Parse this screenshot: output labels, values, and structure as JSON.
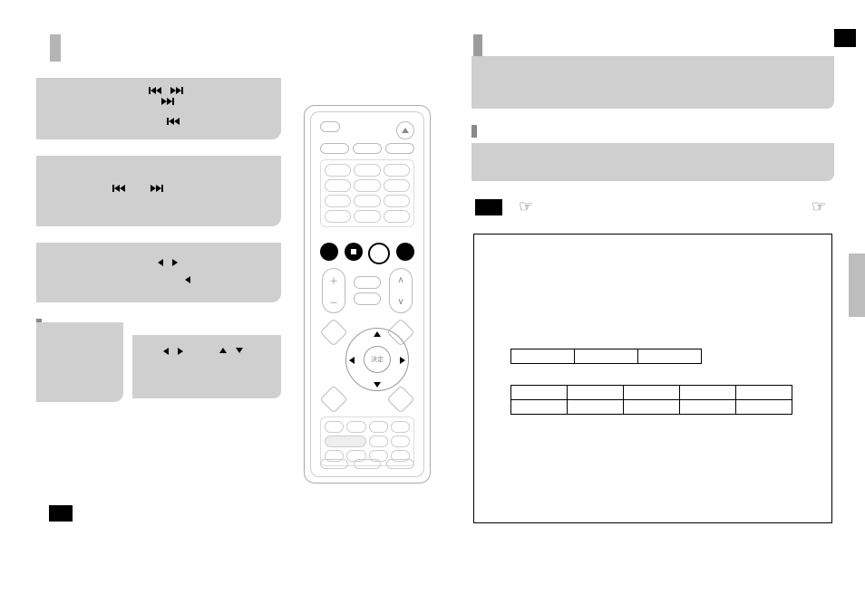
{
  "icons": {
    "skip_prev": "skip-previous",
    "skip_next": "skip-next",
    "prev": "previous",
    "next": "next",
    "left": "left",
    "right": "right",
    "up": "up",
    "down": "down"
  },
  "remote": {
    "eject": "eject",
    "center": "決定"
  }
}
